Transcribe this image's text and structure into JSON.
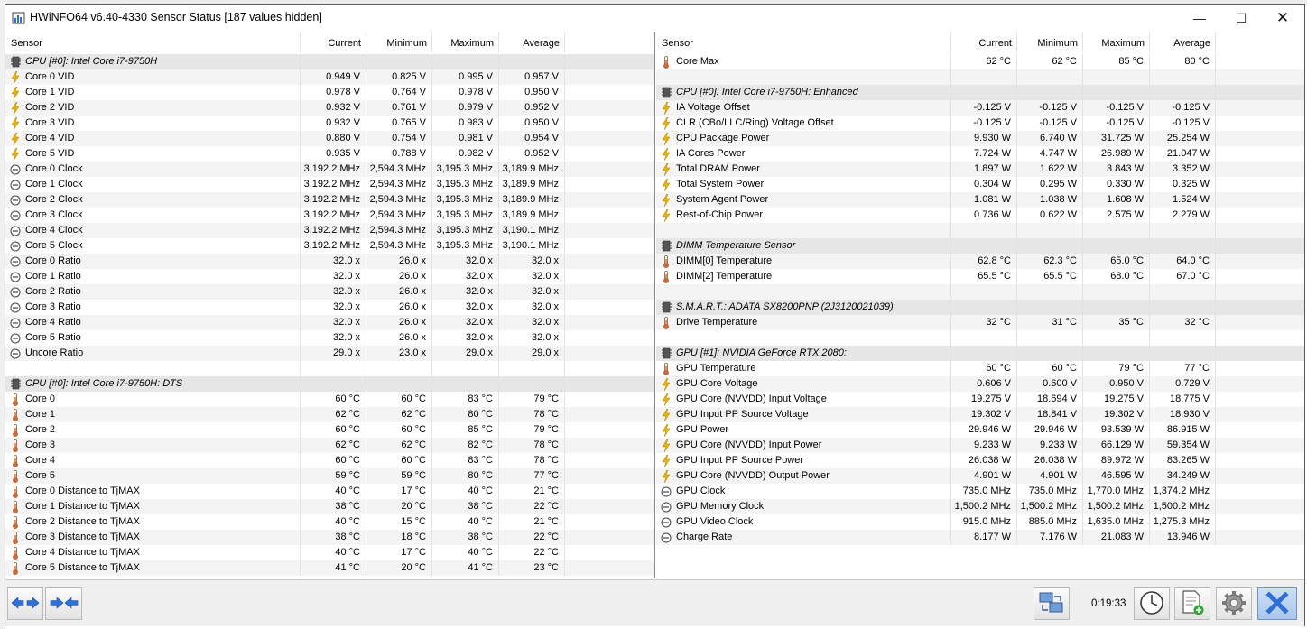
{
  "window": {
    "title": "HWiNFO64 v6.40-4330 Sensor Status [187 values hidden]",
    "minimize": "—",
    "maximize": "☐",
    "close": "✕"
  },
  "columns": {
    "sensor": "Sensor",
    "current": "Current",
    "minimum": "Minimum",
    "maximum": "Maximum",
    "average": "Average"
  },
  "left_rows": [
    {
      "type": "group",
      "name": "CPU [#0]: Intel Core i7-9750H",
      "icon": "chip-icon"
    },
    {
      "type": "row",
      "icon": "voltage-icon",
      "name": "Core 0 VID",
      "cur": "0.949 V",
      "min": "0.825 V",
      "max": "0.995 V",
      "avg": "0.957 V"
    },
    {
      "type": "row",
      "icon": "voltage-icon",
      "name": "Core 1 VID",
      "cur": "0.978 V",
      "min": "0.764 V",
      "max": "0.978 V",
      "avg": "0.950 V"
    },
    {
      "type": "row",
      "icon": "voltage-icon",
      "name": "Core 2 VID",
      "cur": "0.932 V",
      "min": "0.761 V",
      "max": "0.979 V",
      "avg": "0.952 V"
    },
    {
      "type": "row",
      "icon": "voltage-icon",
      "name": "Core 3 VID",
      "cur": "0.932 V",
      "min": "0.765 V",
      "max": "0.983 V",
      "avg": "0.950 V"
    },
    {
      "type": "row",
      "icon": "voltage-icon",
      "name": "Core 4 VID",
      "cur": "0.880 V",
      "min": "0.754 V",
      "max": "0.981 V",
      "avg": "0.954 V"
    },
    {
      "type": "row",
      "icon": "voltage-icon",
      "name": "Core 5 VID",
      "cur": "0.935 V",
      "min": "0.788 V",
      "max": "0.982 V",
      "avg": "0.952 V"
    },
    {
      "type": "row",
      "icon": "clock-icon",
      "name": "Core 0 Clock",
      "cur": "3,192.2 MHz",
      "min": "2,594.3 MHz",
      "max": "3,195.3 MHz",
      "avg": "3,189.9 MHz"
    },
    {
      "type": "row",
      "icon": "clock-icon",
      "name": "Core 1 Clock",
      "cur": "3,192.2 MHz",
      "min": "2,594.3 MHz",
      "max": "3,195.3 MHz",
      "avg": "3,189.9 MHz"
    },
    {
      "type": "row",
      "icon": "clock-icon",
      "name": "Core 2 Clock",
      "cur": "3,192.2 MHz",
      "min": "2,594.3 MHz",
      "max": "3,195.3 MHz",
      "avg": "3,189.9 MHz"
    },
    {
      "type": "row",
      "icon": "clock-icon",
      "name": "Core 3 Clock",
      "cur": "3,192.2 MHz",
      "min": "2,594.3 MHz",
      "max": "3,195.3 MHz",
      "avg": "3,189.9 MHz"
    },
    {
      "type": "row",
      "icon": "clock-icon",
      "name": "Core 4 Clock",
      "cur": "3,192.2 MHz",
      "min": "2,594.3 MHz",
      "max": "3,195.3 MHz",
      "avg": "3,190.1 MHz"
    },
    {
      "type": "row",
      "icon": "clock-icon",
      "name": "Core 5 Clock",
      "cur": "3,192.2 MHz",
      "min": "2,594.3 MHz",
      "max": "3,195.3 MHz",
      "avg": "3,190.1 MHz"
    },
    {
      "type": "row",
      "icon": "clock-icon",
      "name": "Core 0 Ratio",
      "cur": "32.0 x",
      "min": "26.0 x",
      "max": "32.0 x",
      "avg": "32.0 x"
    },
    {
      "type": "row",
      "icon": "clock-icon",
      "name": "Core 1 Ratio",
      "cur": "32.0 x",
      "min": "26.0 x",
      "max": "32.0 x",
      "avg": "32.0 x"
    },
    {
      "type": "row",
      "icon": "clock-icon",
      "name": "Core 2 Ratio",
      "cur": "32.0 x",
      "min": "26.0 x",
      "max": "32.0 x",
      "avg": "32.0 x"
    },
    {
      "type": "row",
      "icon": "clock-icon",
      "name": "Core 3 Ratio",
      "cur": "32.0 x",
      "min": "26.0 x",
      "max": "32.0 x",
      "avg": "32.0 x"
    },
    {
      "type": "row",
      "icon": "clock-icon",
      "name": "Core 4 Ratio",
      "cur": "32.0 x",
      "min": "26.0 x",
      "max": "32.0 x",
      "avg": "32.0 x"
    },
    {
      "type": "row",
      "icon": "clock-icon",
      "name": "Core 5 Ratio",
      "cur": "32.0 x",
      "min": "26.0 x",
      "max": "32.0 x",
      "avg": "32.0 x"
    },
    {
      "type": "row",
      "icon": "clock-icon",
      "name": "Uncore Ratio",
      "cur": "29.0 x",
      "min": "23.0 x",
      "max": "29.0 x",
      "avg": "29.0 x"
    },
    {
      "type": "blank"
    },
    {
      "type": "group",
      "name": "CPU [#0]: Intel Core i7-9750H: DTS",
      "icon": "chip-icon"
    },
    {
      "type": "row",
      "icon": "thermometer-icon",
      "name": "Core 0",
      "cur": "60 °C",
      "min": "60 °C",
      "max": "83 °C",
      "avg": "79 °C"
    },
    {
      "type": "row",
      "icon": "thermometer-icon",
      "name": "Core 1",
      "cur": "62 °C",
      "min": "62 °C",
      "max": "80 °C",
      "avg": "78 °C"
    },
    {
      "type": "row",
      "icon": "thermometer-icon",
      "name": "Core 2",
      "cur": "60 °C",
      "min": "60 °C",
      "max": "85 °C",
      "avg": "79 °C"
    },
    {
      "type": "row",
      "icon": "thermometer-icon",
      "name": "Core 3",
      "cur": "62 °C",
      "min": "62 °C",
      "max": "82 °C",
      "avg": "78 °C"
    },
    {
      "type": "row",
      "icon": "thermometer-icon",
      "name": "Core 4",
      "cur": "60 °C",
      "min": "60 °C",
      "max": "83 °C",
      "avg": "78 °C"
    },
    {
      "type": "row",
      "icon": "thermometer-icon",
      "name": "Core 5",
      "cur": "59 °C",
      "min": "59 °C",
      "max": "80 °C",
      "avg": "77 °C"
    },
    {
      "type": "row",
      "icon": "thermometer-icon",
      "name": "Core 0 Distance to TjMAX",
      "cur": "40 °C",
      "min": "17 °C",
      "max": "40 °C",
      "avg": "21 °C"
    },
    {
      "type": "row",
      "icon": "thermometer-icon",
      "name": "Core 1 Distance to TjMAX",
      "cur": "38 °C",
      "min": "20 °C",
      "max": "38 °C",
      "avg": "22 °C"
    },
    {
      "type": "row",
      "icon": "thermometer-icon",
      "name": "Core 2 Distance to TjMAX",
      "cur": "40 °C",
      "min": "15 °C",
      "max": "40 °C",
      "avg": "21 °C"
    },
    {
      "type": "row",
      "icon": "thermometer-icon",
      "name": "Core 3 Distance to TjMAX",
      "cur": "38 °C",
      "min": "18 °C",
      "max": "38 °C",
      "avg": "22 °C"
    },
    {
      "type": "row",
      "icon": "thermometer-icon",
      "name": "Core 4 Distance to TjMAX",
      "cur": "40 °C",
      "min": "17 °C",
      "max": "40 °C",
      "avg": "22 °C"
    },
    {
      "type": "row",
      "icon": "thermometer-icon",
      "name": "Core 5 Distance to TjMAX",
      "cur": "41 °C",
      "min": "20 °C",
      "max": "41 °C",
      "avg": "23 °C"
    }
  ],
  "right_rows": [
    {
      "type": "row",
      "icon": "thermometer-icon",
      "name": "Core Max",
      "cur": "62 °C",
      "min": "62 °C",
      "max": "85 °C",
      "avg": "80 °C"
    },
    {
      "type": "blank"
    },
    {
      "type": "group",
      "name": "CPU [#0]: Intel Core i7-9750H: Enhanced",
      "icon": "chip-icon"
    },
    {
      "type": "row",
      "icon": "voltage-icon",
      "name": "IA Voltage Offset",
      "cur": "-0.125 V",
      "min": "-0.125 V",
      "max": "-0.125 V",
      "avg": "-0.125 V"
    },
    {
      "type": "row",
      "icon": "voltage-icon",
      "name": "CLR (CBo/LLC/Ring) Voltage Offset",
      "cur": "-0.125 V",
      "min": "-0.125 V",
      "max": "-0.125 V",
      "avg": "-0.125 V"
    },
    {
      "type": "row",
      "icon": "voltage-icon",
      "name": "CPU Package Power",
      "cur": "9.930 W",
      "min": "6.740 W",
      "max": "31.725 W",
      "avg": "25.254 W"
    },
    {
      "type": "row",
      "icon": "voltage-icon",
      "name": "IA Cores Power",
      "cur": "7.724 W",
      "min": "4.747 W",
      "max": "26.989 W",
      "avg": "21.047 W"
    },
    {
      "type": "row",
      "icon": "voltage-icon",
      "name": "Total DRAM Power",
      "cur": "1.897 W",
      "min": "1.622 W",
      "max": "3.843 W",
      "avg": "3.352 W"
    },
    {
      "type": "row",
      "icon": "voltage-icon",
      "name": "Total System Power",
      "cur": "0.304 W",
      "min": "0.295 W",
      "max": "0.330 W",
      "avg": "0.325 W"
    },
    {
      "type": "row",
      "icon": "voltage-icon",
      "name": "System Agent Power",
      "cur": "1.081 W",
      "min": "1.038 W",
      "max": "1.608 W",
      "avg": "1.524 W"
    },
    {
      "type": "row",
      "icon": "voltage-icon",
      "name": "Rest-of-Chip Power",
      "cur": "0.736 W",
      "min": "0.622 W",
      "max": "2.575 W",
      "avg": "2.279 W"
    },
    {
      "type": "blank"
    },
    {
      "type": "group",
      "name": "DIMM Temperature Sensor",
      "icon": "chip-icon"
    },
    {
      "type": "row",
      "icon": "thermometer-icon",
      "name": "DIMM[0] Temperature",
      "cur": "62.8 °C",
      "min": "62.3 °C",
      "max": "65.0 °C",
      "avg": "64.0 °C"
    },
    {
      "type": "row",
      "icon": "thermometer-icon",
      "name": "DIMM[2] Temperature",
      "cur": "65.5 °C",
      "min": "65.5 °C",
      "max": "68.0 °C",
      "avg": "67.0 °C"
    },
    {
      "type": "blank"
    },
    {
      "type": "group",
      "name": "S.M.A.R.T.: ADATA SX8200PNP (2J3120021039)",
      "icon": "chip-icon"
    },
    {
      "type": "row",
      "icon": "thermometer-icon",
      "name": "Drive Temperature",
      "cur": "32 °C",
      "min": "31 °C",
      "max": "35 °C",
      "avg": "32 °C"
    },
    {
      "type": "blank"
    },
    {
      "type": "group",
      "name": "GPU [#1]: NVIDIA GeForce RTX 2080:",
      "icon": "chip-icon"
    },
    {
      "type": "row",
      "icon": "thermometer-icon",
      "name": "GPU Temperature",
      "cur": "60 °C",
      "min": "60 °C",
      "max": "79 °C",
      "avg": "77 °C"
    },
    {
      "type": "row",
      "icon": "voltage-icon",
      "name": "GPU Core Voltage",
      "cur": "0.606 V",
      "min": "0.600 V",
      "max": "0.950 V",
      "avg": "0.729 V"
    },
    {
      "type": "row",
      "icon": "voltage-icon",
      "name": "GPU Core (NVVDD) Input Voltage",
      "cur": "19.275 V",
      "min": "18.694 V",
      "max": "19.275 V",
      "avg": "18.775 V"
    },
    {
      "type": "row",
      "icon": "voltage-icon",
      "name": "GPU Input PP Source Voltage",
      "cur": "19.302 V",
      "min": "18.841 V",
      "max": "19.302 V",
      "avg": "18.930 V"
    },
    {
      "type": "row",
      "icon": "voltage-icon",
      "name": "GPU Power",
      "cur": "29.946 W",
      "min": "29.946 W",
      "max": "93.539 W",
      "avg": "86.915 W"
    },
    {
      "type": "row",
      "icon": "voltage-icon",
      "name": "GPU Core (NVVDD) Input Power",
      "cur": "9.233 W",
      "min": "9.233 W",
      "max": "66.129 W",
      "avg": "59.354 W"
    },
    {
      "type": "row",
      "icon": "voltage-icon",
      "name": "GPU Input PP Source Power",
      "cur": "26.038 W",
      "min": "26.038 W",
      "max": "89.972 W",
      "avg": "83.265 W"
    },
    {
      "type": "row",
      "icon": "voltage-icon",
      "name": "GPU Core (NVVDD) Output Power",
      "cur": "4.901 W",
      "min": "4.901 W",
      "max": "46.595 W",
      "avg": "34.249 W"
    },
    {
      "type": "row",
      "icon": "clock-icon",
      "name": "GPU Clock",
      "cur": "735.0 MHz",
      "min": "735.0 MHz",
      "max": "1,770.0 MHz",
      "avg": "1,374.2 MHz"
    },
    {
      "type": "row",
      "icon": "clock-icon",
      "name": "GPU Memory Clock",
      "cur": "1,500.2 MHz",
      "min": "1,500.2 MHz",
      "max": "1,500.2 MHz",
      "avg": "1,500.2 MHz"
    },
    {
      "type": "row",
      "icon": "clock-icon",
      "name": "GPU Video Clock",
      "cur": "915.0 MHz",
      "min": "885.0 MHz",
      "max": "1,635.0 MHz",
      "avg": "1,275.3 MHz"
    },
    {
      "type": "row",
      "icon": "clock-icon",
      "name": "Charge Rate",
      "cur": "8.177 W",
      "min": "7.176 W",
      "max": "21.083 W",
      "avg": "13.946 W"
    }
  ],
  "footer": {
    "elapsed_time": "0:19:33"
  },
  "colors": {
    "voltage": "#e8b400",
    "thermometer": "#3a6fd0",
    "chip": "#555555",
    "nav_arrow": "#2f6fd6",
    "close_button": "#2f6fd6"
  }
}
